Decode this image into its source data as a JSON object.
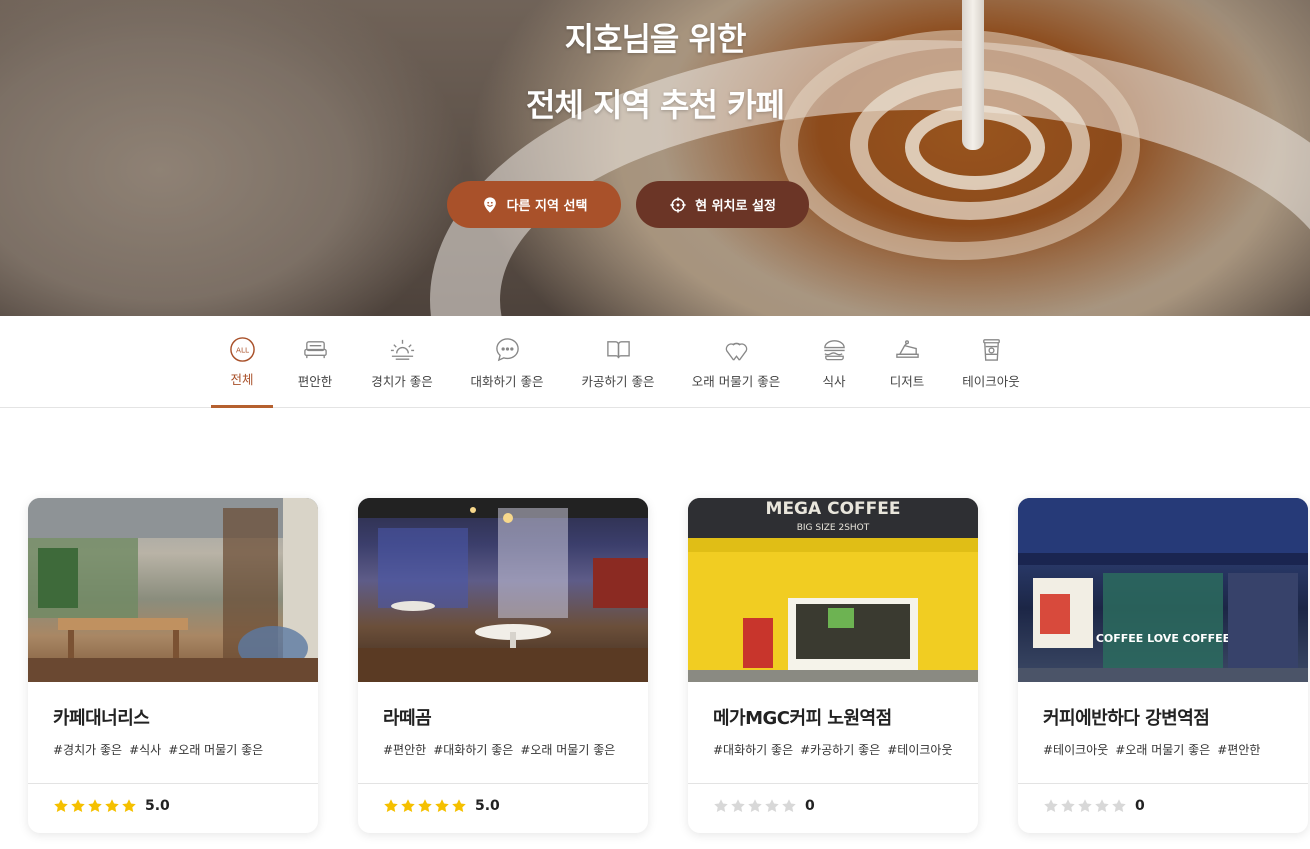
{
  "hero": {
    "title_line1": "지호님을 위한",
    "title_line2": "전체 지역 추천 카페",
    "region_button": "다른 지역 선택",
    "location_button": "현 위치로 설정"
  },
  "categories": [
    {
      "label": "전체",
      "icon": "all-icon",
      "active": true
    },
    {
      "label": "편안한",
      "icon": "bed-icon"
    },
    {
      "label": "경치가 좋은",
      "icon": "sunrise-icon"
    },
    {
      "label": "대화하기 좋은",
      "icon": "chat-bubble-icon"
    },
    {
      "label": "카공하기 좋은",
      "icon": "book-icon"
    },
    {
      "label": "오래 머물기 좋은",
      "icon": "hearts-icon"
    },
    {
      "label": "식사",
      "icon": "burger-icon"
    },
    {
      "label": "디저트",
      "icon": "cake-icon"
    },
    {
      "label": "테이크아웃",
      "icon": "takeout-cup-icon"
    }
  ],
  "cafes": [
    {
      "name": "카페대너리스",
      "tags": [
        "#경치가 좋은",
        "#식사",
        "#오래 머물기 좋은"
      ],
      "rating": 5,
      "score": "5.0"
    },
    {
      "name": "라떼곰",
      "tags": [
        "#편안한",
        "#대화하기 좋은",
        "#오래 머물기 좋은"
      ],
      "rating": 5,
      "score": "5.0"
    },
    {
      "name": "메가MGC커피 노원역점",
      "tags": [
        "#대화하기 좋은",
        "#카공하기 좋은",
        "#테이크아웃"
      ],
      "rating": 0,
      "score": "0",
      "sign_text": "MEGA COFFEE",
      "sign_sub": "BIG SIZE 2SHOT"
    },
    {
      "name": "커피에반하다 강변역점",
      "tags": [
        "#테이크아웃",
        "#오래 머물기 좋은",
        "#편안한"
      ],
      "rating": 0,
      "score": "0",
      "sign_text": "COFFEE LOVE COFFEE"
    }
  ],
  "colors": {
    "accent": "#a9512a",
    "accent_dark": "#6b3526",
    "star_filled": "#f5c000",
    "star_empty": "#d8d8d8"
  }
}
